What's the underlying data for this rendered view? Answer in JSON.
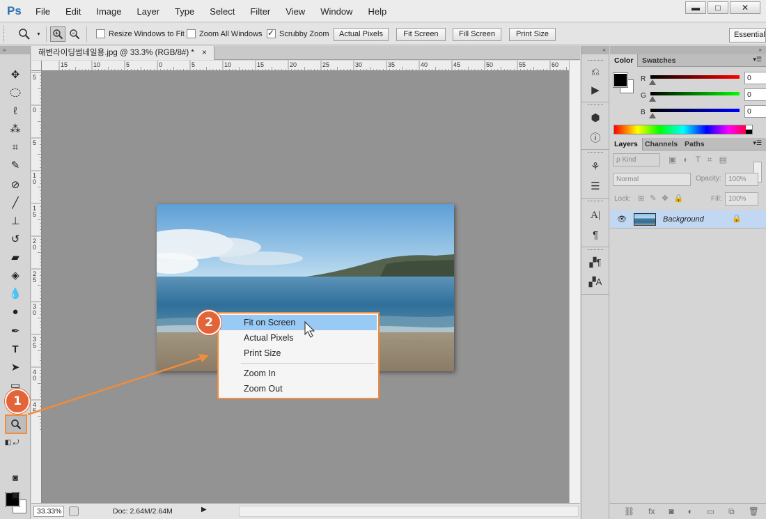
{
  "app": {
    "logo": "Ps"
  },
  "menu": [
    "File",
    "Edit",
    "Image",
    "Layer",
    "Type",
    "Select",
    "Filter",
    "View",
    "Window",
    "Help"
  ],
  "window_controls": {
    "minimize": "▬",
    "maximize": "□",
    "close": "✕"
  },
  "options_bar": {
    "resize_windows": "Resize Windows to Fit",
    "zoom_all": "Zoom All Windows",
    "scrubby": "Scrubby Zoom",
    "actual_pixels": "Actual Pixels",
    "fit_screen": "Fit Screen",
    "fill_screen": "Fill Screen",
    "print_size": "Print Size",
    "workspace": "Essentials"
  },
  "document": {
    "tab_title": "해변라이딩썸네일용.jpg @ 33.3% (RGB/8#) *",
    "tab_close": "×",
    "ruler_top": [
      "15",
      "10",
      "5",
      "0",
      "5",
      "10",
      "15",
      "20",
      "25",
      "30",
      "35",
      "40",
      "45",
      "50",
      "55",
      "60"
    ],
    "ruler_left": [
      "5",
      "0",
      "5",
      "1 0",
      "1 5",
      "2 0",
      "2 5",
      "3 0",
      "3 5",
      "4 0",
      "4 5"
    ]
  },
  "status": {
    "zoom": "33.33%",
    "doc": "Doc: 2.64M/2.64M"
  },
  "context_menu": {
    "items": [
      "Fit on Screen",
      "Actual Pixels",
      "Print Size",
      "Zoom In",
      "Zoom Out"
    ],
    "highlighted": "Fit on Screen"
  },
  "callouts": {
    "one": "1",
    "two": "2"
  },
  "color_panel": {
    "tabs": [
      "Color",
      "Swatches"
    ],
    "r_label": "R",
    "g_label": "G",
    "b_label": "B",
    "r": "0",
    "g": "0",
    "b": "0"
  },
  "layers_panel": {
    "tabs": [
      "Layers",
      "Channels",
      "Paths"
    ],
    "kind": "ρ Kind",
    "blend_mode": "Normal",
    "opacity_label": "Opacity:",
    "opacity": "100%",
    "lock_label": "Lock:",
    "fill_label": "Fill:",
    "fill": "100%",
    "layer_name": "Background"
  },
  "accent": "#f08c3c"
}
